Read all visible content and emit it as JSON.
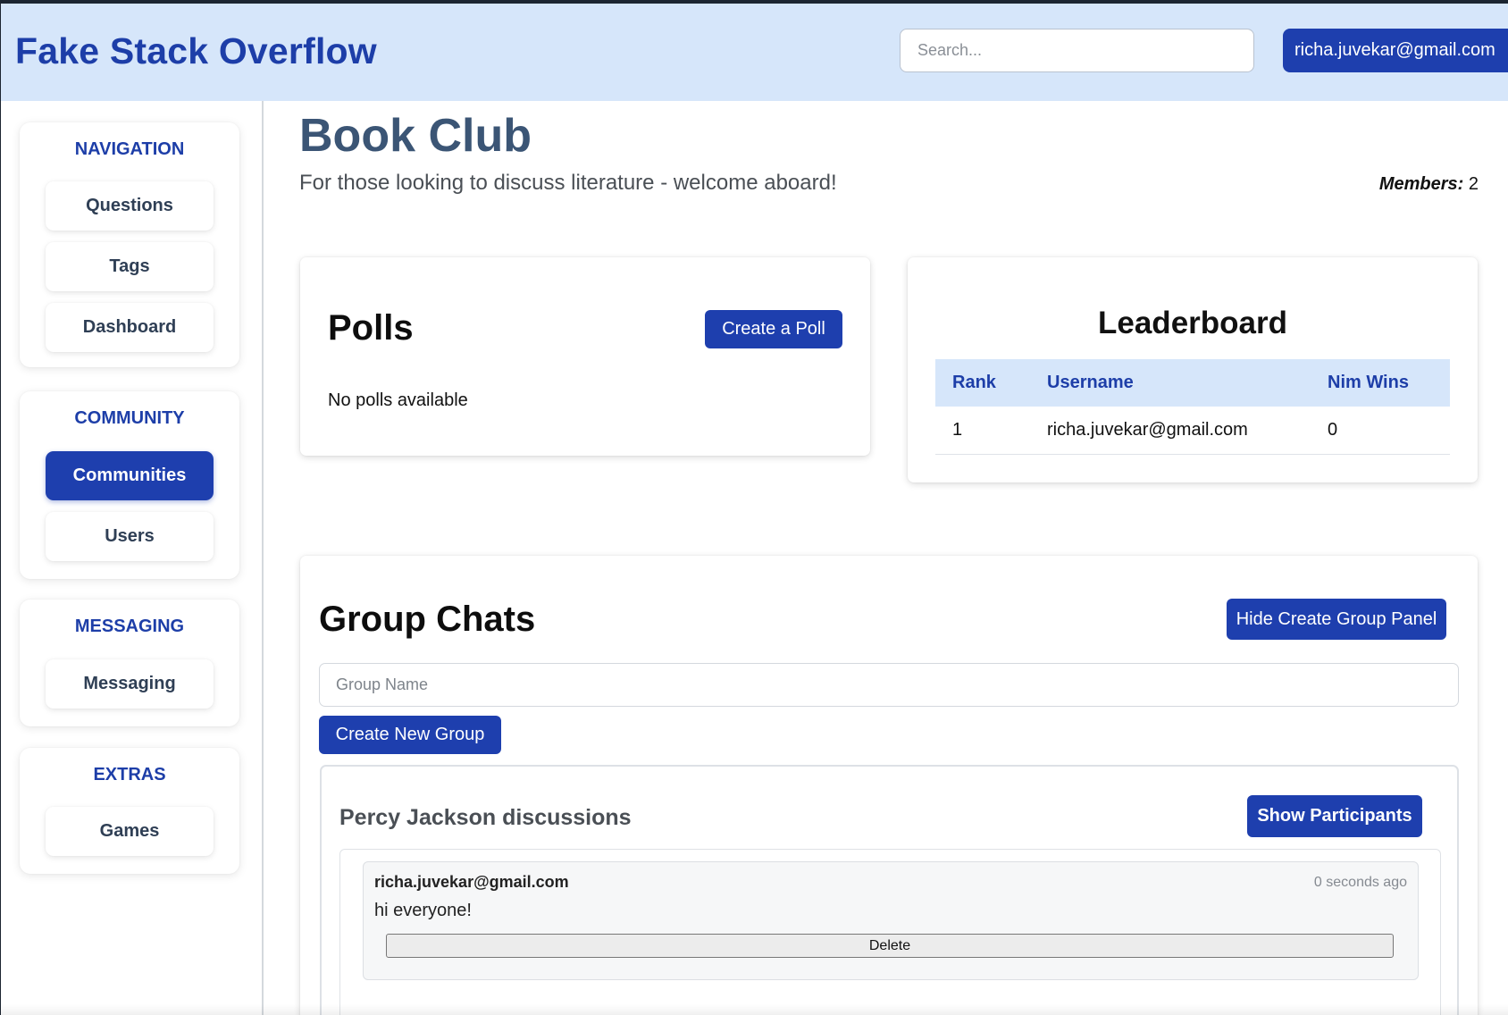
{
  "header": {
    "logo": "Fake Stack Overflow",
    "search_placeholder": "Search...",
    "user_email": "richa.juvekar@gmail.com"
  },
  "sidebar": {
    "groups": [
      {
        "title": "NAVIGATION",
        "items": [
          "Questions",
          "Tags",
          "Dashboard"
        ]
      },
      {
        "title": "COMMUNITY",
        "items": [
          "Communities",
          "Users"
        ],
        "active": "Communities"
      },
      {
        "title": "MESSAGING",
        "items": [
          "Messaging"
        ]
      },
      {
        "title": "EXTRAS",
        "items": [
          "Games"
        ]
      }
    ]
  },
  "community": {
    "title": "Book Club",
    "description": "For those looking to discuss literature - welcome aboard!",
    "members_label": "Members:",
    "members_count": "2"
  },
  "polls": {
    "title": "Polls",
    "create_label": "Create a Poll",
    "empty_text": "No polls available"
  },
  "leaderboard": {
    "title": "Leaderboard",
    "columns": [
      "Rank",
      "Username",
      "Nim Wins"
    ],
    "rows": [
      {
        "rank": "1",
        "username": "richa.juvekar@gmail.com",
        "wins": "0"
      }
    ]
  },
  "group_chats": {
    "title": "Group Chats",
    "toggle_label": "Hide Create Group Panel",
    "group_name_placeholder": "Group Name",
    "create_label": "Create New Group",
    "chats": [
      {
        "name": "Percy Jackson discussions",
        "show_participants_label": "Show Participants",
        "messages": [
          {
            "user": "richa.juvekar@gmail.com",
            "time": "0 seconds ago",
            "text": "hi everyone!",
            "delete_label": "Delete"
          }
        ]
      }
    ]
  },
  "colors": {
    "header_bg": "#d6e6fa",
    "brand_blue": "#1d3ea8",
    "button_blue": "#1e3fae",
    "title_slate": "#3b5575"
  }
}
